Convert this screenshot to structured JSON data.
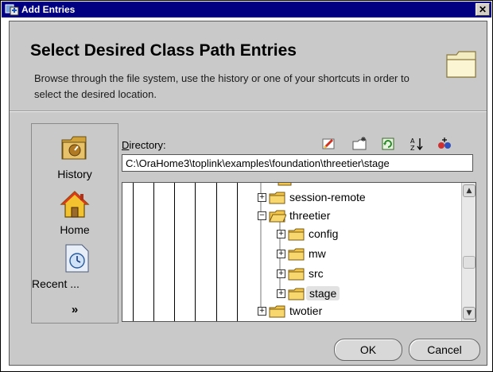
{
  "window": {
    "title": "Add Entries",
    "close_glyph": "✕"
  },
  "header": {
    "title": "Select Desired Class Path Entries",
    "description": "Browse through the file system, use the history or one of your shortcuts in order to select the desired location."
  },
  "shortcuts": {
    "items": [
      {
        "label": "History",
        "icon": "history-icon"
      },
      {
        "label": "Home",
        "icon": "home-icon"
      },
      {
        "label": "Recent ...",
        "icon": "recent-icon"
      }
    ],
    "more_label": "»"
  },
  "directory": {
    "label_mnemonic": "D",
    "label_rest": "irectory:",
    "value": "C:\\OraHome3\\toplink\\examples\\foundation\\threetier\\stage"
  },
  "toolbar": {
    "icons": [
      "edit-icon",
      "new-folder-icon",
      "refresh-icon",
      "sort-icon",
      "network-icon"
    ]
  },
  "tree": {
    "rows": [
      {
        "label": "session-remote",
        "expander": "+"
      },
      {
        "label": "threetier",
        "expander": "−"
      },
      {
        "label": "config",
        "expander": "+"
      },
      {
        "label": "mw",
        "expander": "+"
      },
      {
        "label": "src",
        "expander": "+"
      },
      {
        "label": "stage",
        "expander": "+",
        "selected": true
      },
      {
        "label": "twotier",
        "expander": "+"
      }
    ]
  },
  "buttons": {
    "ok_label": "OK",
    "cancel_label": "Cancel"
  },
  "colors": {
    "titlebar": "#000080",
    "dialog_bg": "#c9c9c9",
    "folder": "#f3c64a"
  }
}
